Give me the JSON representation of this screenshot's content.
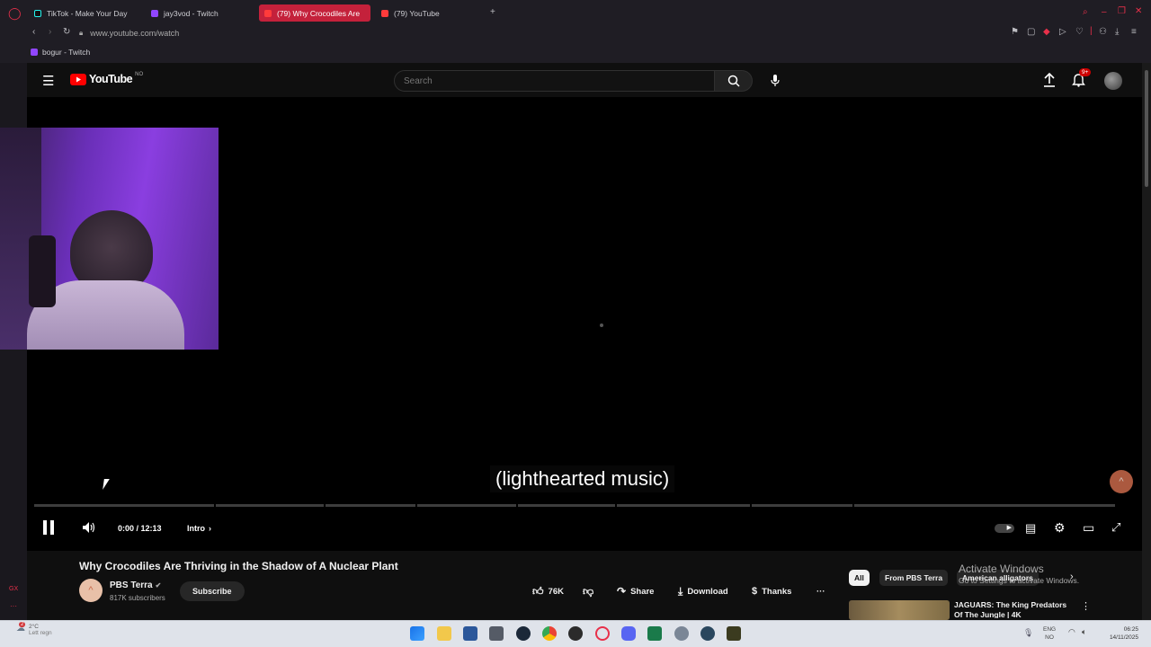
{
  "browser": {
    "tabs": [
      {
        "label": "TikTok - Make Your Day",
        "active": false
      },
      {
        "label": "jay3vod - Twitch",
        "active": false
      },
      {
        "label": "(79) Why Crocodiles Are",
        "active": true
      },
      {
        "label": "(79) YouTube",
        "active": false
      }
    ],
    "address": "www.youtube.com/watch",
    "bookmark": "bogur - Twitch"
  },
  "youtube": {
    "logo": "YouTube",
    "region": "NO",
    "search_placeholder": "Search",
    "notif_count": "9+"
  },
  "player": {
    "caption": "(lighthearted music)",
    "time": "0:00 / 12:13",
    "chapter": "Intro"
  },
  "video": {
    "title": "Why Crocodiles Are Thriving in the Shadow of A Nuclear Plant",
    "channel": "PBS Terra",
    "subscribers": "817K subscribers",
    "subscribe": "Subscribe",
    "likes": "76K",
    "share": "Share",
    "download": "Download",
    "thanks": "Thanks"
  },
  "recs": {
    "chips": [
      "All",
      "From PBS Terra",
      "American alligators"
    ],
    "first_title": "JAGUARS: The King Predators Of The Jungle | 4K"
  },
  "overlay": {
    "activate_title": "Activate Windows",
    "activate_sub": "Go to Settings to activate Windows."
  },
  "taskbar": {
    "weather_temp": "2°C",
    "weather_desc": "Lett regn",
    "lang": "ENG",
    "lang2": "NO",
    "time": "06:25",
    "date": "14/11/2025",
    "badge": "2"
  },
  "colors": {
    "accent": "#c4213b",
    "yt_red": "#ff0000",
    "bg": "#0f0f0f"
  }
}
